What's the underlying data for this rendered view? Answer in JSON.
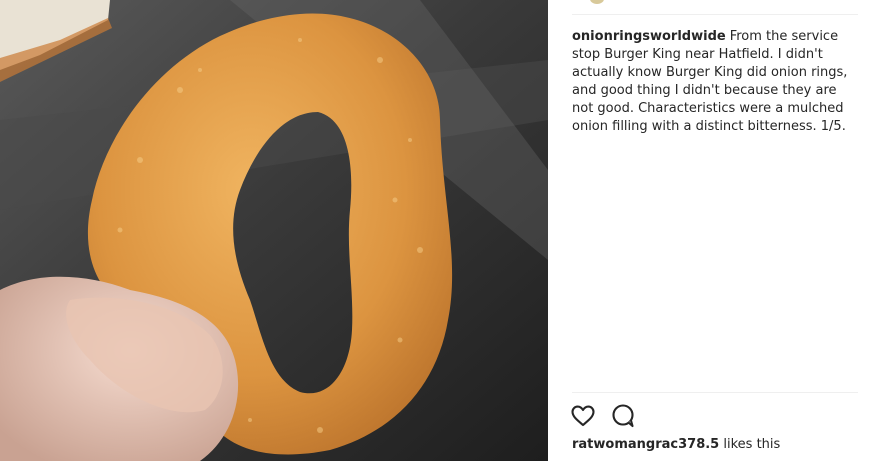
{
  "post": {
    "username": "onionringsworldwide",
    "caption": "From the service stop Burger King near Hatfield. I didn't actually know Burger King did onion rings, and good thing I didn't because they are not good. Characteristics were a mulched onion filling with a distinct bitterness. 1/5.",
    "liker": "ratwomangrac378.5",
    "likes_suffix": "likes this"
  },
  "icons": {
    "like": "heart-outline-icon",
    "comment": "speech-bubble-icon"
  },
  "colors": {
    "text": "#262626",
    "divider": "#efefef",
    "ring": "#d9913a"
  }
}
